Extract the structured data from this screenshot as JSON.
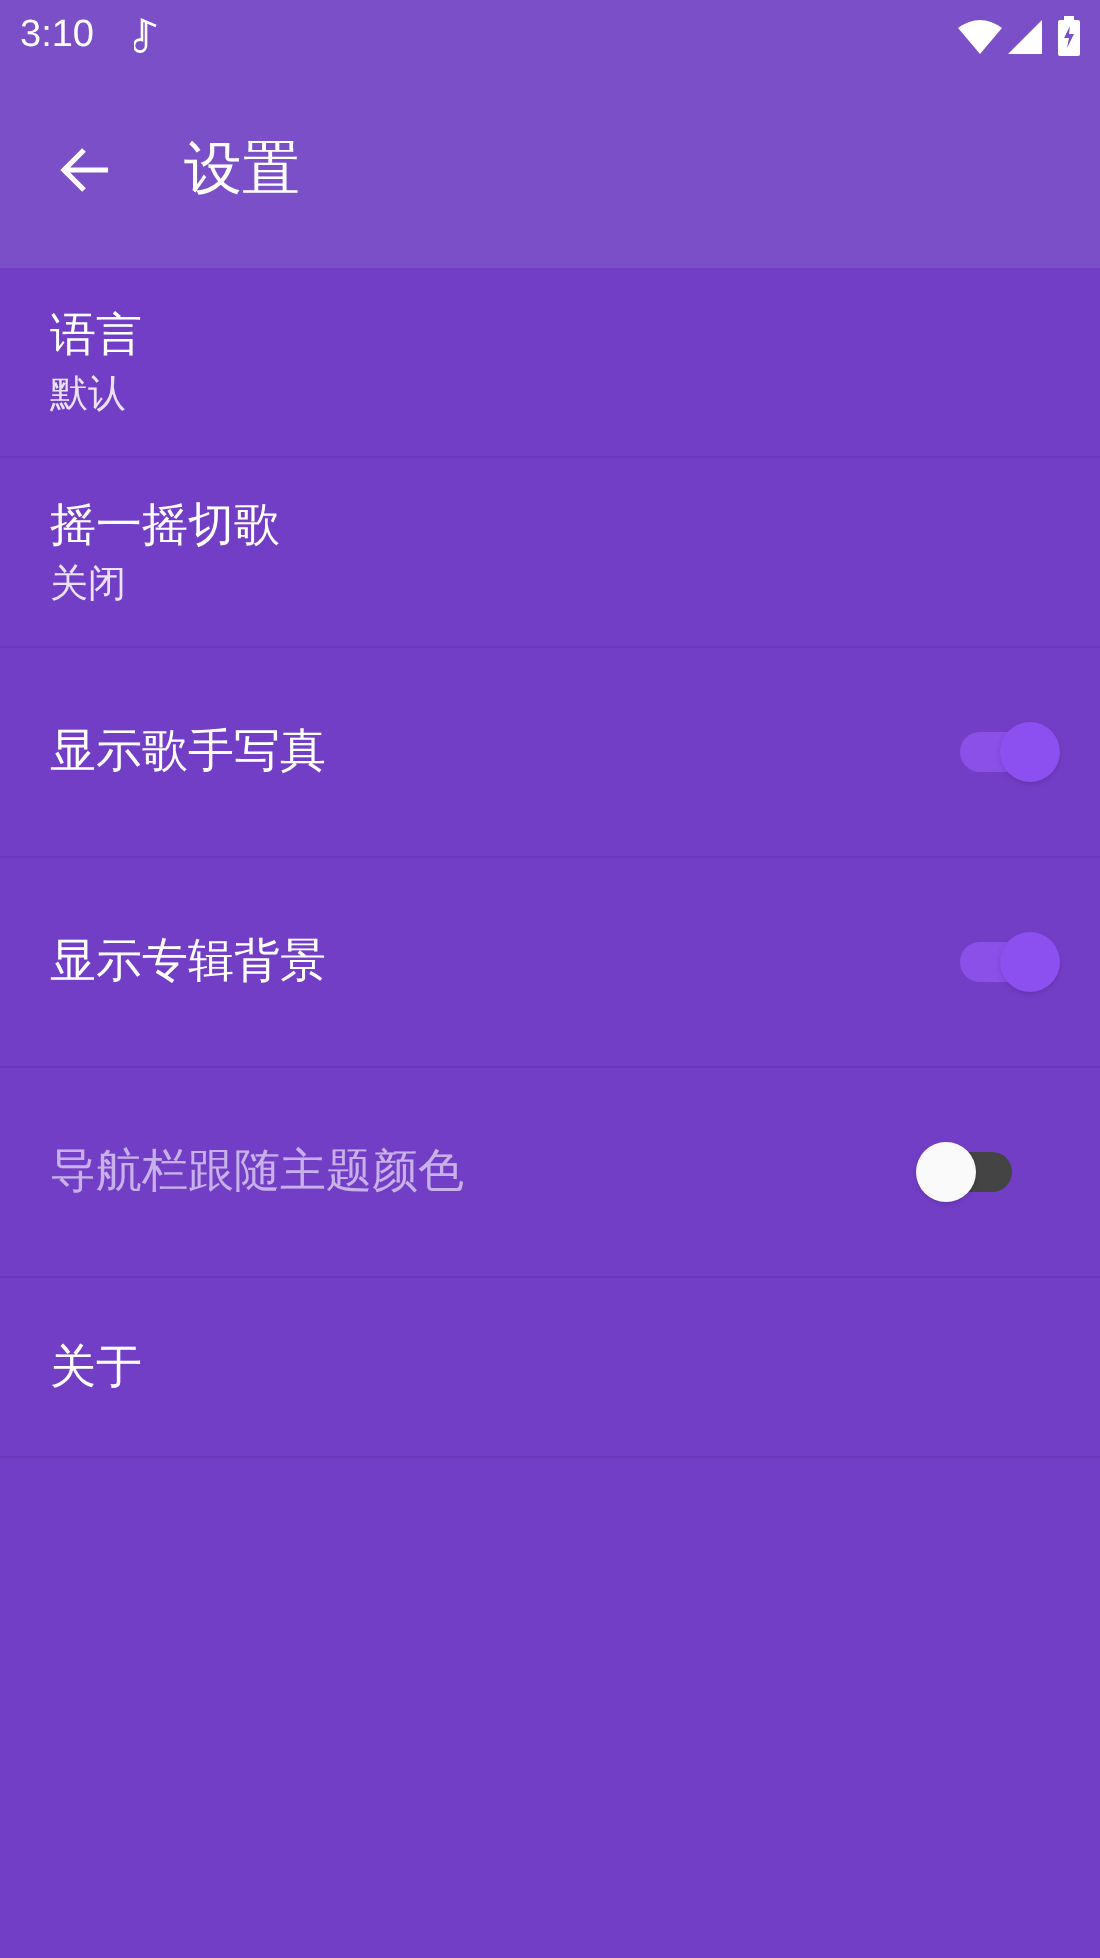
{
  "status_bar": {
    "time": "3:10"
  },
  "toolbar": {
    "title": "设置"
  },
  "items": [
    {
      "kind": "text",
      "title": "语言",
      "summary": "默认",
      "disabled": false
    },
    {
      "kind": "text",
      "title": "摇一摇切歌",
      "summary": "关闭",
      "disabled": false
    },
    {
      "kind": "switch",
      "title": "显示歌手写真",
      "on": true,
      "disabled": false
    },
    {
      "kind": "switch",
      "title": "显示专辑背景",
      "on": true,
      "disabled": false
    },
    {
      "kind": "switch",
      "title": "导航栏跟随主题颜色",
      "on": false,
      "disabled": true
    },
    {
      "kind": "plain",
      "title": "关于",
      "disabled": false
    }
  ]
}
